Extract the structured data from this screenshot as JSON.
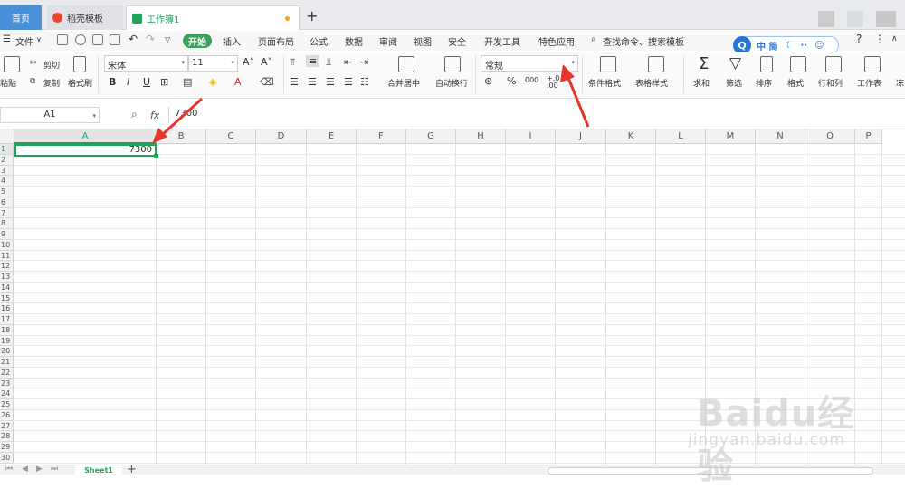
{
  "tabs": {
    "home": "首页",
    "template": "稻壳模板",
    "workbook": "工作簿1",
    "new_tab": "+"
  },
  "menu": {
    "file": "文件",
    "start": "开始",
    "insert": "插入",
    "page_layout": "页面布局",
    "formulas": "公式",
    "data": "数据",
    "review": "审阅",
    "view": "视图",
    "security": "安全",
    "developer": "开发工具",
    "special": "特色应用",
    "search": "查找命令、搜索模板",
    "help": "?"
  },
  "ime": {
    "q": "Q",
    "mode": "中 简"
  },
  "ribbon": {
    "paste": "粘贴",
    "cut": "剪切",
    "copy": "复制",
    "format_painter": "格式刷",
    "font_name": "宋体",
    "font_size": "11",
    "merge_center": "合并居中",
    "wrap_text": "自动换行",
    "number_format": "常规",
    "percent": "%",
    "thousands": "000",
    "decimal_inc": "+.0",
    "decimal_dec": ".00",
    "conditional_format": "条件格式",
    "table_style": "表格样式",
    "sum": "求和",
    "filter": "筛选",
    "sort": "排序",
    "format": "格式",
    "rows_cols": "行和列",
    "worksheet": "工作表",
    "more": "冻"
  },
  "formula_bar": {
    "cell_ref": "A1",
    "fx": "fx",
    "value": "7300"
  },
  "grid": {
    "columns": [
      "A",
      "B",
      "C",
      "D",
      "E",
      "F",
      "G",
      "H",
      "I",
      "J",
      "K",
      "L",
      "M",
      "N",
      "O",
      "P"
    ],
    "rows": [
      "1",
      "2",
      "3",
      "4",
      "5",
      "6",
      "7",
      "8",
      "9",
      "10",
      "11",
      "12",
      "13",
      "14",
      "15",
      "16",
      "17",
      "18",
      "19",
      "20",
      "21",
      "22",
      "23",
      "24",
      "25",
      "26",
      "27",
      "28",
      "29",
      "30"
    ],
    "active_cell_value": "7300"
  },
  "sheets": {
    "active": "Sheet1",
    "add": "+"
  },
  "watermark": {
    "logo": "Baidu经验",
    "url": "jingyan.baidu.com"
  },
  "colors": {
    "accent_green": "#22a35a",
    "annotation_red": "#e8352c",
    "home_tab_blue": "#4a90d9"
  }
}
